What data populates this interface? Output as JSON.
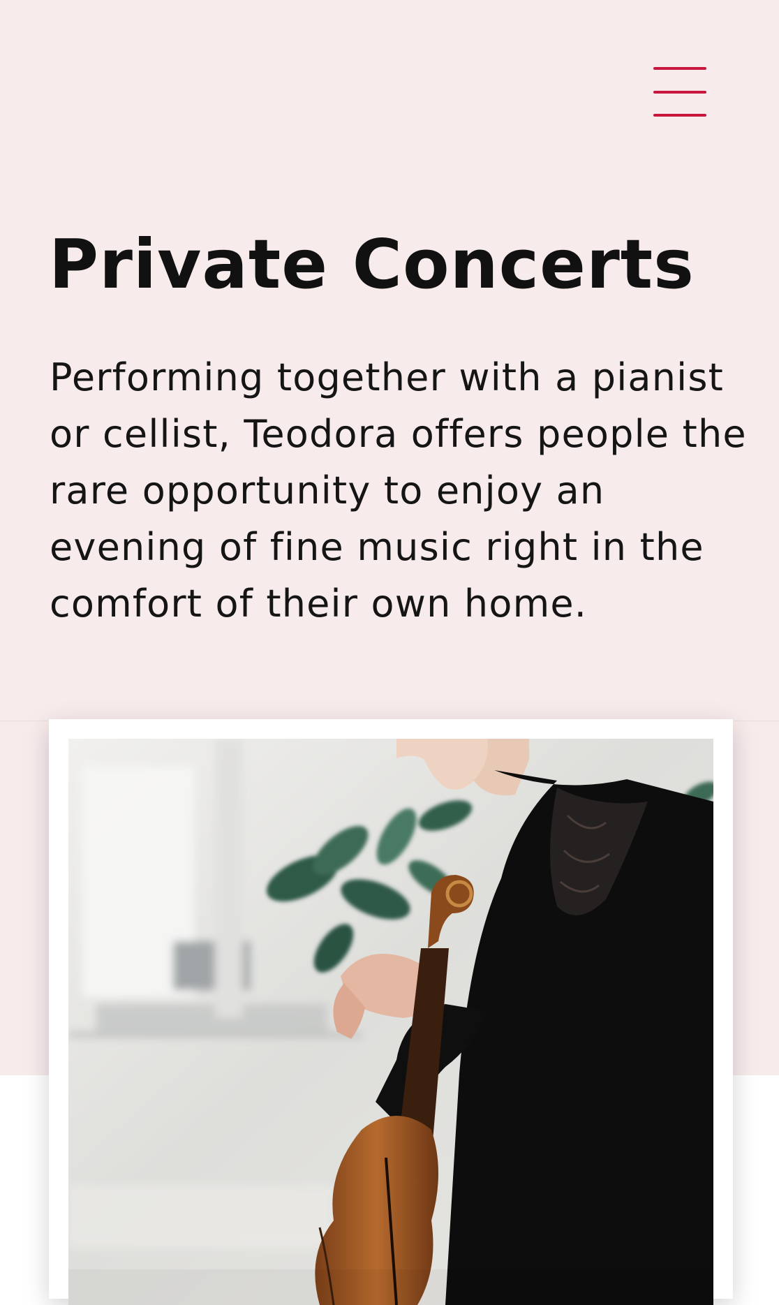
{
  "header": {
    "menu_icon": "hamburger-menu-icon",
    "accent_color": "#c8163c"
  },
  "hero": {
    "title": "Private Concerts",
    "description_lines": [
      "Performing together with a pianist",
      "or cellist, Teodora offers people the",
      "rare opportunity to enjoy an",
      "evening of fine music right in the",
      "comfort of their own home."
    ],
    "background_color": "#f7ebec"
  },
  "photo": {
    "subject": "violinist-holding-violin-photo"
  }
}
